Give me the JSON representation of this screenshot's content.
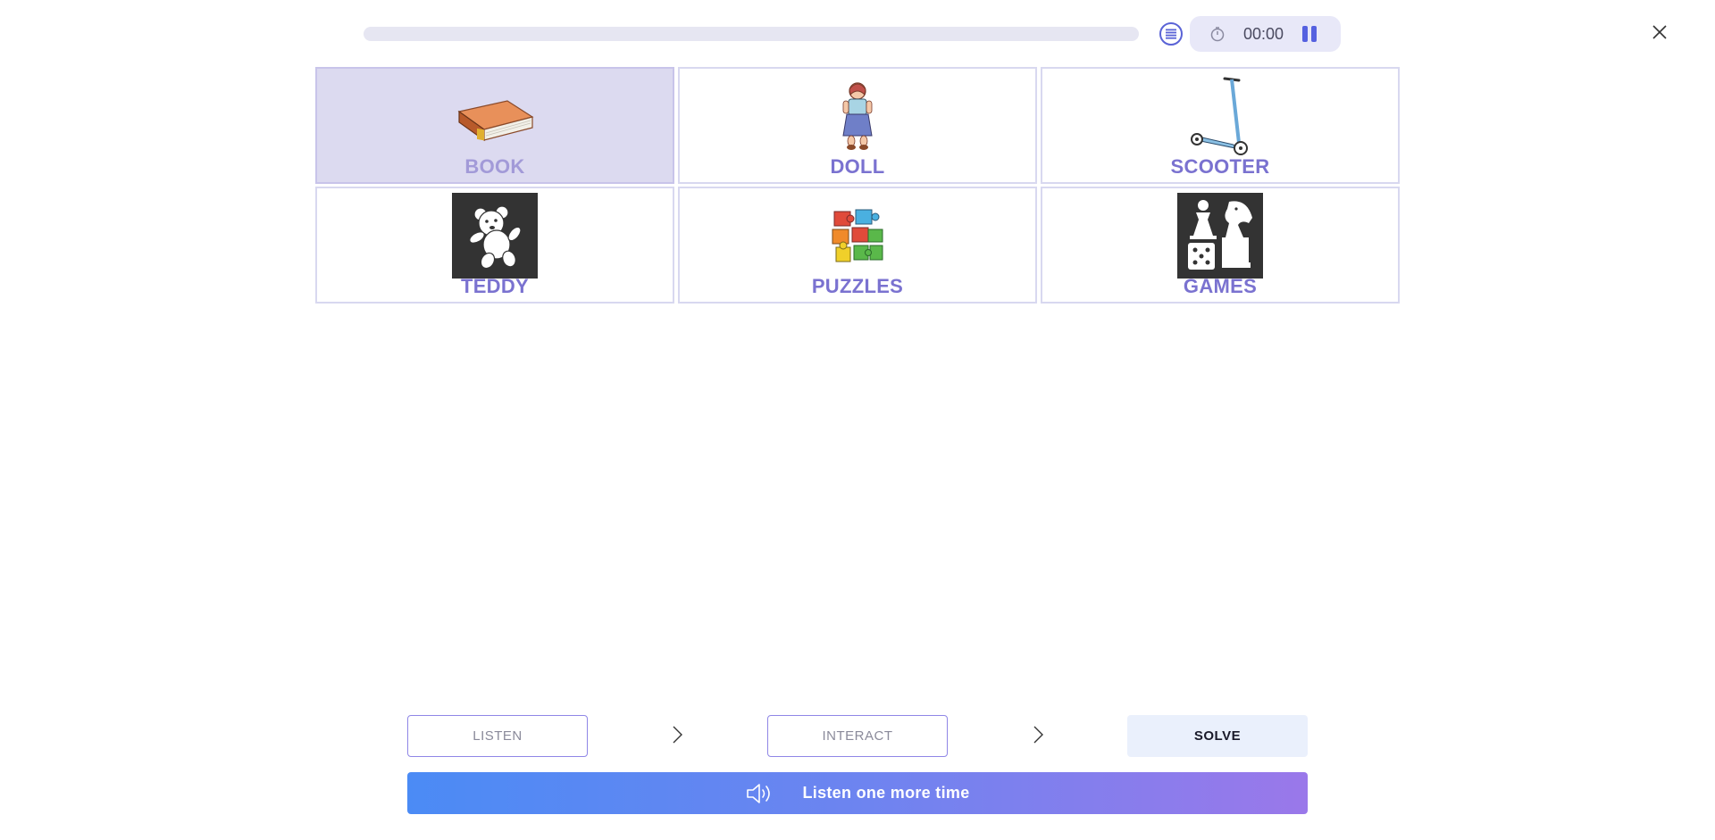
{
  "timer": {
    "value": "00:00"
  },
  "progress": {
    "fraction": 0
  },
  "cards": [
    {
      "label": "BOOK",
      "icon": "book-icon",
      "selected": true
    },
    {
      "label": "DOLL",
      "icon": "doll-icon",
      "selected": false
    },
    {
      "label": "SCOOTER",
      "icon": "scooter-icon",
      "selected": false
    },
    {
      "label": "TEDDY",
      "icon": "teddy-bear-icon",
      "selected": false
    },
    {
      "label": "PUZZLES",
      "icon": "puzzle-pieces-icon",
      "selected": false
    },
    {
      "label": "GAMES",
      "icon": "board-games-icon",
      "selected": false
    }
  ],
  "steps": {
    "listen": "LISTEN",
    "interact": "INTERACT",
    "solve": "SOLVE"
  },
  "listen_again": "Listen one more time",
  "colors": {
    "accent": "#7a72d0",
    "gradient_start": "#4b8bf5",
    "gradient_end": "#9a78ea",
    "selected_bg": "#dcdaf0"
  }
}
